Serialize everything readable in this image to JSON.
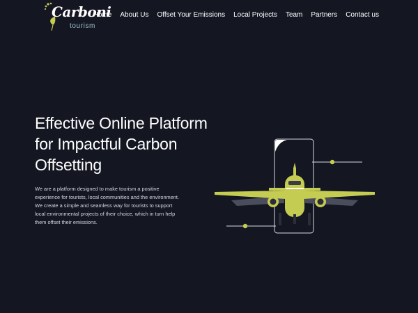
{
  "brand": {
    "name": "Carboni",
    "tagline": "tourism"
  },
  "nav": {
    "items": [
      {
        "label": "Home"
      },
      {
        "label": "About Us"
      },
      {
        "label": "Offset Your Emissions"
      },
      {
        "label": "Local Projects"
      },
      {
        "label": "Team"
      },
      {
        "label": "Partners"
      },
      {
        "label": "Contact us"
      }
    ]
  },
  "hero": {
    "title": "Effective Online Platform for Impactful Carbon Offsetting",
    "description": "We are a platform designed to make tourism a positive experience for tourists, local communities and the environment. We create a simple and seamless way for tourists to support local environmental projects of their choice, which in turn help them offset their emissions."
  },
  "colors": {
    "background": "#141722",
    "accent": "#c5cc52",
    "text": "#ffffff"
  },
  "icons": {
    "logo": "footprint-leaf-icon",
    "illustration": "airplane-phone-illustration"
  }
}
